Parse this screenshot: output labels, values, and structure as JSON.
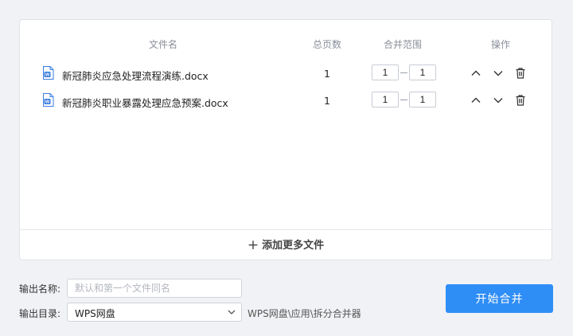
{
  "table": {
    "headers": {
      "name": "文件名",
      "pages": "总页数",
      "range": "合并范围",
      "ops": "操作"
    },
    "rows": [
      {
        "name": "新冠肺炎应急处理流程演练.docx",
        "pages": "1",
        "from": "1",
        "to": "1"
      },
      {
        "name": "新冠肺炎职业暴露处理应急预案.docx",
        "pages": "1",
        "from": "1",
        "to": "1"
      }
    ]
  },
  "add_more": "添加更多文件",
  "output": {
    "name_label": "输出名称:",
    "name_placeholder": "默认和第一个文件同名",
    "dir_label": "输出目录:",
    "dir_value": "WPS网盘",
    "dir_path": "WPS网盘\\应用\\拆分合并器"
  },
  "start_button": "开始合并",
  "colors": {
    "accent": "#2f8ef6",
    "doc_icon": "#3b7de0"
  },
  "icons": {
    "doc": "word-doc-icon",
    "up": "chevron-up-icon",
    "down": "chevron-down-icon",
    "delete": "trash-icon",
    "add": "plus-icon",
    "select": "chevron-down-icon"
  }
}
